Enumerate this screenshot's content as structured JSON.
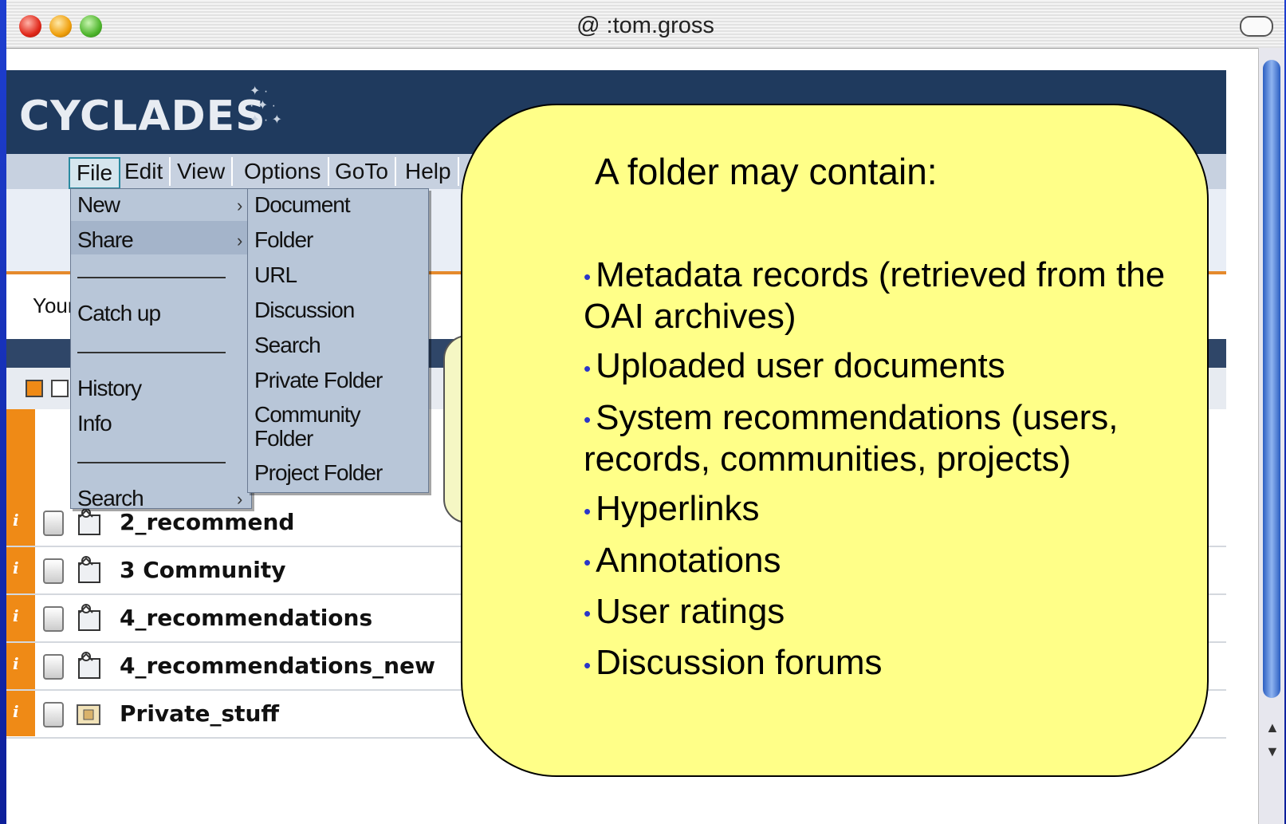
{
  "window": {
    "title": "@ :tom.gross"
  },
  "app": {
    "logo": "CYCLADES"
  },
  "menubar": {
    "items": [
      "File",
      "Edit",
      "View",
      "Options",
      "GoTo",
      "Help"
    ]
  },
  "file_menu": {
    "items": [
      "New",
      "Share",
      "Catch up",
      "History",
      "Info",
      "Search"
    ]
  },
  "new_submenu": {
    "items": [
      "Document",
      "Folder",
      "URL",
      "Discussion",
      "Search",
      "Private Folder",
      "Community Folder",
      "Project Folder"
    ]
  },
  "page": {
    "your_label": "Your"
  },
  "folders": [
    {
      "name": "2_recommend",
      "icon": "community-folder-icon"
    },
    {
      "name": "3 Community",
      "icon": "community-folder-icon"
    },
    {
      "name": "4_recommendations",
      "icon": "community-folder-icon"
    },
    {
      "name": "4_recommendations_new",
      "icon": "community-folder-icon"
    },
    {
      "name": "Private_stuff",
      "icon": "private-folder-icon"
    }
  ],
  "callout": {
    "title": "A folder may contain:",
    "bullets": [
      "Metadata records (retrieved from the OAI archives)",
      "Uploaded user documents",
      "System recommendations (users, records, communities, projects)",
      "Hyperlinks",
      "Annotations",
      "User ratings",
      "Discussion forums"
    ]
  },
  "colors": {
    "callout_bg": "#ffff88",
    "banner": "#1f3a5e",
    "accent_orange": "#ef8a16",
    "slide_bg": "#1e3fd0"
  }
}
